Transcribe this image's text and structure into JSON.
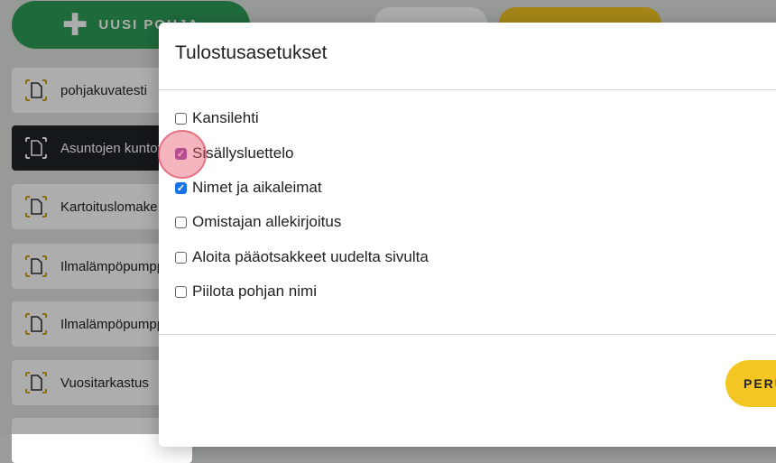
{
  "toolbar": {
    "new_template_label": "UUSI POHJA"
  },
  "sidebar": {
    "items": [
      {
        "label": "pohjakuvatesti",
        "active": false
      },
      {
        "label": "Asuntojen kuntotarkastus",
        "active": true
      },
      {
        "label": "Kartoituslomake",
        "active": false
      },
      {
        "label": "Ilmalämpöpumppu",
        "active": false
      },
      {
        "label": "Ilmalämpöpumppu",
        "active": false
      },
      {
        "label": "Vuositarkastus",
        "active": false
      }
    ]
  },
  "dialog": {
    "title": "Tulostusasetukset",
    "options": [
      {
        "label": "Kansilehti",
        "checked": false
      },
      {
        "label": "Sisällysluettelo",
        "checked": true
      },
      {
        "label": "Nimet ja aikaleimat",
        "checked": true
      },
      {
        "label": "Omistajan allekirjoitus",
        "checked": false
      },
      {
        "label": "Aloita pääotsakkeet uudelta sivulta",
        "checked": false
      },
      {
        "label": "Piilota pohjan nimi",
        "checked": false
      }
    ],
    "cancel_label": "PERU"
  },
  "colors": {
    "green": "#2f9d57",
    "yellow": "#f3c623",
    "dark": "#1f2428",
    "checkbox_blue": "#1a73e8"
  }
}
